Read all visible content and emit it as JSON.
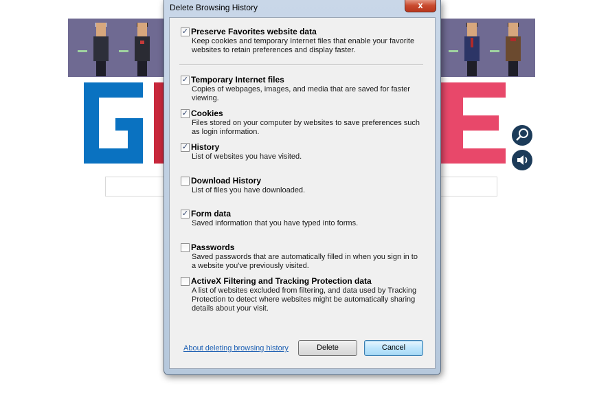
{
  "dialog": {
    "title": "Delete Browsing History",
    "close_label": "x",
    "options": [
      {
        "label": "Preserve Favorites website data",
        "checked": true,
        "description": "Keep cookies and temporary Internet files that enable your favorite websites to retain preferences and display faster."
      },
      {
        "label": "Temporary Internet files",
        "checked": true,
        "description": "Copies of webpages, images, and media that are saved for faster viewing."
      },
      {
        "label": "Cookies",
        "checked": true,
        "description": "Files stored on your computer by websites to save preferences such as login information."
      },
      {
        "label": "History",
        "checked": true,
        "description": "List of websites you have visited."
      },
      {
        "label": "Download History",
        "checked": false,
        "description": "List of files you have downloaded."
      },
      {
        "label": "Form data",
        "checked": true,
        "description": "Saved information that you have typed into forms."
      },
      {
        "label": "Passwords",
        "checked": false,
        "description": "Saved passwords that are automatically filled in when you sign in to a website you've previously visited."
      },
      {
        "label": "ActiveX Filtering and Tracking Protection data",
        "checked": false,
        "description": "A list of websites excluded from filtering, and data used by Tracking Protection to detect where websites might be automatically sharing details about your visit."
      }
    ],
    "link_label": "About deleting browsing history",
    "delete_label": "Delete",
    "cancel_label": "Cancel"
  },
  "background": {
    "banner_color": "#6f6a92",
    "logo_blue": "#0a72c1",
    "logo_pink": "#e8486a",
    "logo_red": "#c8283c"
  }
}
